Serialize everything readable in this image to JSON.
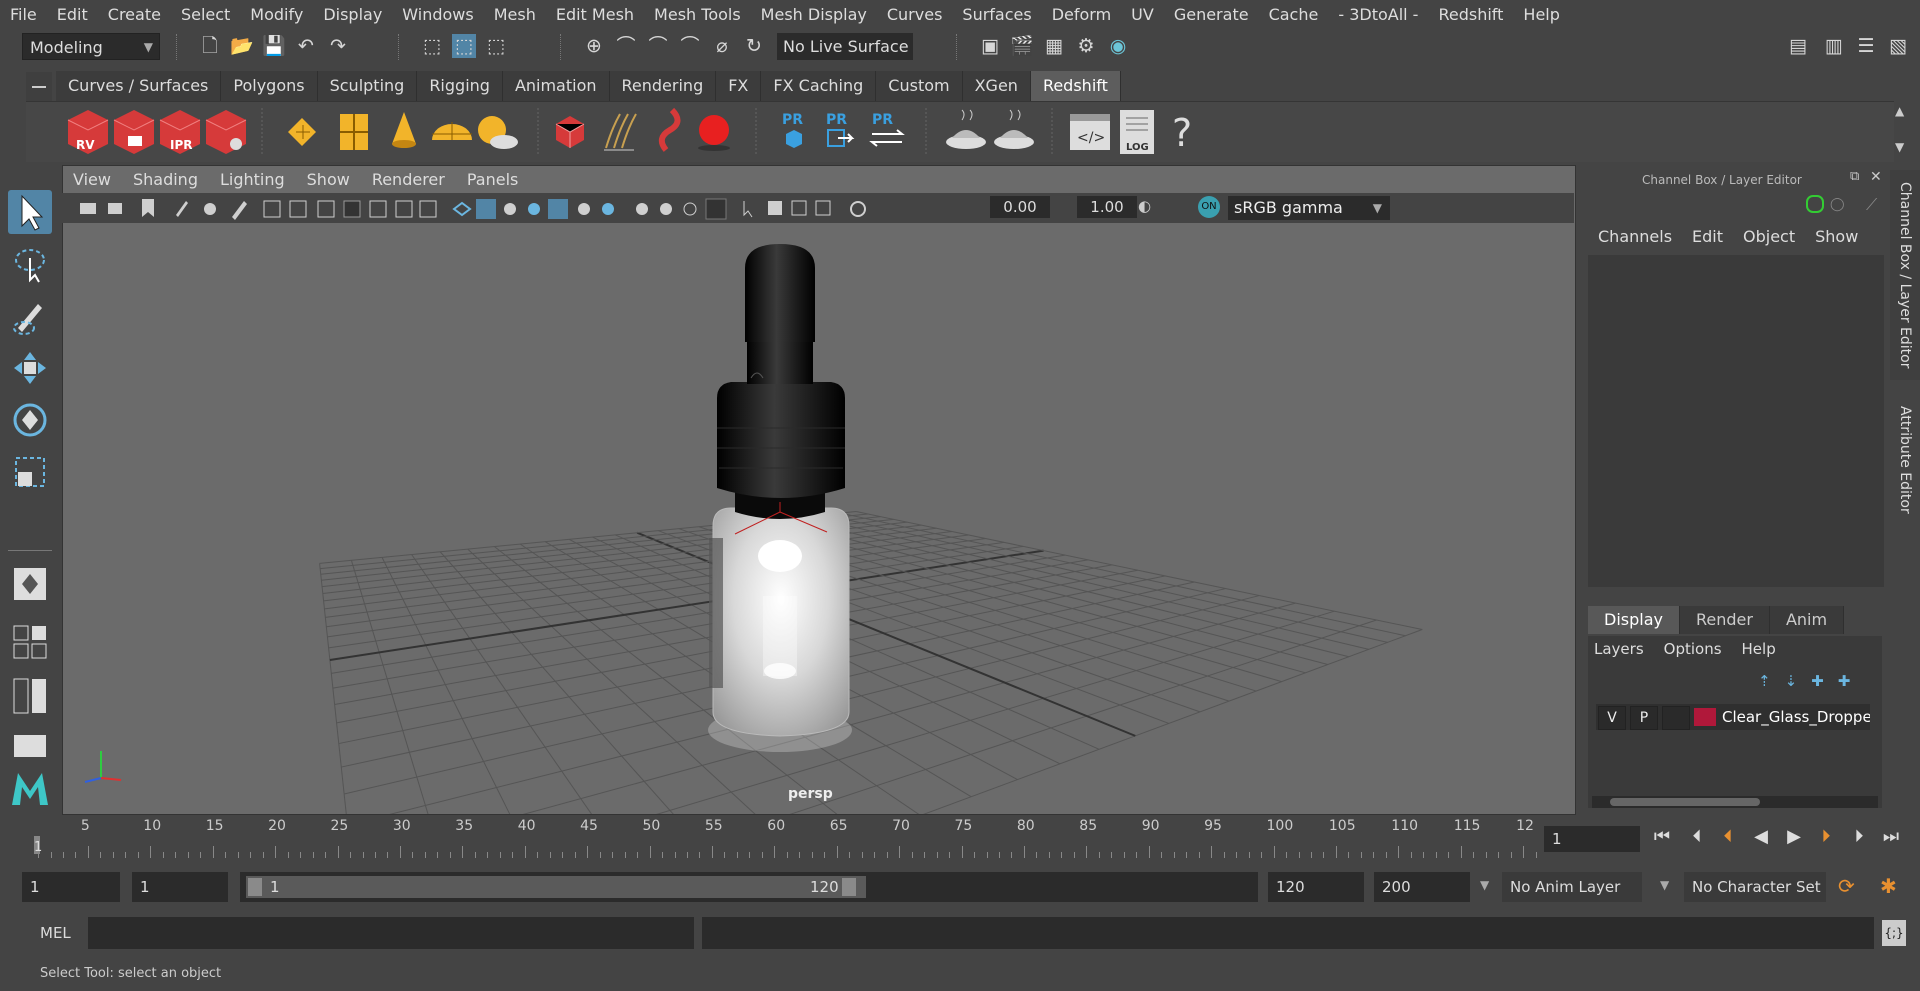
{
  "menu": [
    "File",
    "Edit",
    "Create",
    "Select",
    "Modify",
    "Display",
    "Windows",
    "Mesh",
    "Edit Mesh",
    "Mesh Tools",
    "Mesh Display",
    "Curves",
    "Surfaces",
    "Deform",
    "UV",
    "Generate",
    "Cache",
    "- 3DtoAll -",
    "Redshift",
    "Help"
  ],
  "status_line": {
    "mode": "Modeling",
    "live_surface": "No Live Surface"
  },
  "shelf_tabs": [
    "Curves / Surfaces",
    "Polygons",
    "Sculpting",
    "Rigging",
    "Animation",
    "Rendering",
    "FX",
    "FX Caching",
    "Custom",
    "XGen",
    "Redshift"
  ],
  "shelf_active": "Redshift",
  "shelf_labels": {
    "rv": "RV",
    "ipr": "IPR",
    "pr": "PR",
    "log": "LOG",
    "help": "?"
  },
  "viewport": {
    "menu": [
      "View",
      "Shading",
      "Lighting",
      "Show",
      "Renderer",
      "Panels"
    ],
    "exposure": "0.00",
    "gamma_value": "1.00",
    "color_space": "sRGB gamma",
    "camera_label": "persp"
  },
  "channel_box": {
    "title": "Channel Box / Layer Editor",
    "menu": [
      "Channels",
      "Edit",
      "Object",
      "Show"
    ]
  },
  "layer_editor": {
    "tabs": [
      "Display",
      "Render",
      "Anim"
    ],
    "active_tab": "Display",
    "menu": [
      "Layers",
      "Options",
      "Help"
    ],
    "layers": [
      {
        "v": "V",
        "p": "P",
        "color": "#b0183a",
        "name": "Clear_Glass_Dropper_B"
      }
    ]
  },
  "side_tabs": [
    "Channel Box / Layer Editor",
    "Attribute Editor"
  ],
  "timeline": {
    "ticks": [
      "5",
      "10",
      "15",
      "20",
      "25",
      "30",
      "35",
      "40",
      "45",
      "50",
      "55",
      "60",
      "65",
      "70",
      "75",
      "80",
      "85",
      "90",
      "95",
      "100",
      "105",
      "110",
      "115",
      "12"
    ],
    "current_frame_marker": "1",
    "current_frame_field": "1"
  },
  "range": {
    "start_field": "1",
    "start_playback": "1",
    "slider_start": "1",
    "slider_end": "120",
    "end_playback": "120",
    "end_field": "200",
    "anim_layer": "No Anim Layer",
    "character_set": "No Character Set"
  },
  "command_line": {
    "label": "MEL"
  },
  "help_line": "Select Tool: select an object"
}
